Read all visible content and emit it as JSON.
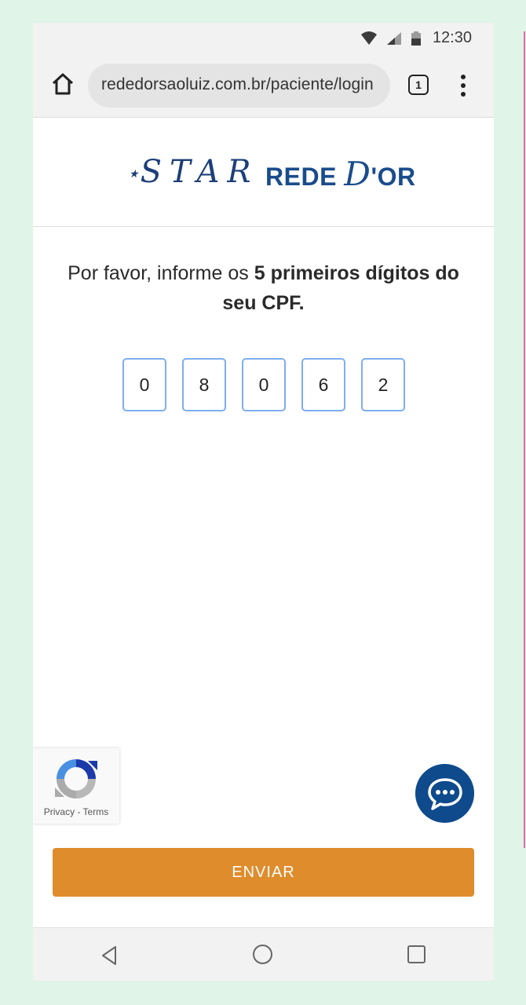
{
  "status_bar": {
    "time": "12:30"
  },
  "browser": {
    "url": "rededorsaoluiz.com.br/paciente/login",
    "tab_count": "1"
  },
  "brand": {
    "star_logo": "STAR",
    "rede_logo_prefix": "REDE ",
    "rede_logo_d": "D",
    "rede_logo_suffix": "'OR"
  },
  "prompt": {
    "text_before": "Por favor, informe os ",
    "text_bold": "5 primeiros dígitos do seu CPF."
  },
  "cpf_digits": [
    "0",
    "8",
    "0",
    "6",
    "2"
  ],
  "recaptcha": {
    "links": "Privacy - Terms"
  },
  "submit_label": "ENVIAR",
  "colors": {
    "brand_blue": "#0f4a8c",
    "submit_orange": "#df8c2c",
    "input_border": "#7faeed"
  }
}
